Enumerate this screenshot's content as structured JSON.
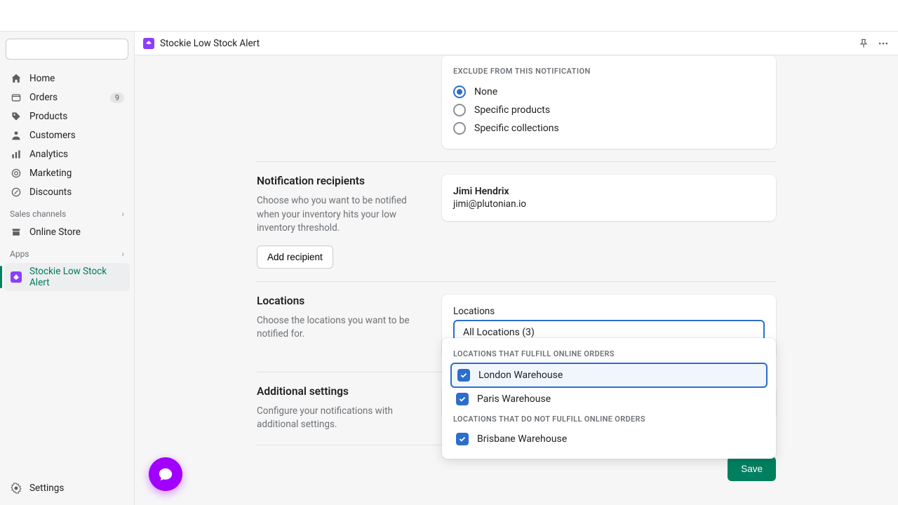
{
  "app": {
    "title": "Stockie Low Stock Alert"
  },
  "sidebar": {
    "search_placeholder": "",
    "items": [
      {
        "label": "Home"
      },
      {
        "label": "Orders",
        "badge": "9"
      },
      {
        "label": "Products"
      },
      {
        "label": "Customers"
      },
      {
        "label": "Analytics"
      },
      {
        "label": "Marketing"
      },
      {
        "label": "Discounts"
      }
    ],
    "sales_header": "Sales channels",
    "sales": [
      {
        "label": "Online Store"
      }
    ],
    "apps_header": "Apps",
    "apps": [
      {
        "label": "Stockie Low Stock Alert"
      }
    ],
    "settings": "Settings"
  },
  "exclude": {
    "heading": "EXCLUDE FROM THIS NOTIFICATION",
    "options": [
      "None",
      "Specific products",
      "Specific collections"
    ],
    "selected": 0
  },
  "recipients": {
    "title": "Notification recipients",
    "desc": "Choose who you want to be notified when your inventory hits your low inventory threshold.",
    "add_label": "Add recipient",
    "list": [
      {
        "name": "Jimi Hendrix",
        "email": "jimi@plutonian.io"
      }
    ]
  },
  "locations": {
    "title": "Locations",
    "desc": "Choose the locations you want to be notified for.",
    "field_label": "Locations",
    "select_value": "All Locations (3)",
    "group1_header": "LOCATIONS THAT FULFILL ONLINE ORDERS",
    "group1": [
      "London Warehouse",
      "Paris Warehouse"
    ],
    "group2_header": "LOCATIONS THAT DO NOT FULFILL ONLINE ORDERS",
    "group2": [
      "Brisbane Warehouse"
    ]
  },
  "additional": {
    "title": "Additional settings",
    "desc": "Configure your notifications with additional settings."
  },
  "footer": {
    "save": "Save"
  }
}
